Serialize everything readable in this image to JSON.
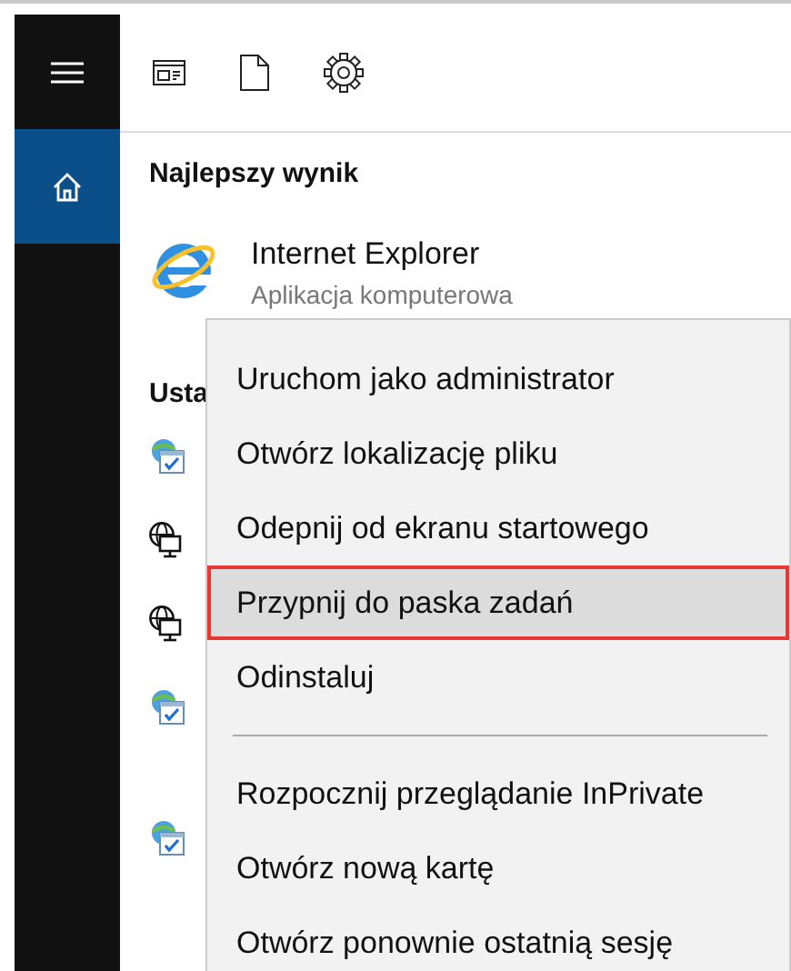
{
  "sidebar": {
    "items": [
      {
        "kind": "menu",
        "selected": false
      },
      {
        "kind": "home",
        "selected": true
      }
    ]
  },
  "toolbar": {
    "icons": [
      {
        "kind": "apps"
      },
      {
        "kind": "documents"
      },
      {
        "kind": "settings"
      }
    ]
  },
  "best_match": {
    "heading": "Najlepszy wynik",
    "title": "Internet Explorer",
    "subtitle": "Aplikacja komputerowa"
  },
  "settings": {
    "heading": "Usta",
    "items": [
      {
        "kind": "ie-settings"
      },
      {
        "kind": "network"
      },
      {
        "kind": "network"
      },
      {
        "kind": "ie-settings"
      },
      {
        "kind": "ie-settings"
      }
    ]
  },
  "context_menu": {
    "groups": [
      [
        {
          "label": "Uruchom jako administrator",
          "selected": false
        },
        {
          "label": "Otwórz lokalizację pliku",
          "selected": false
        },
        {
          "label": "Odepnij od ekranu startowego",
          "selected": false
        },
        {
          "label": "Przypnij do paska zadań",
          "selected": true
        },
        {
          "label": "Odinstaluj",
          "selected": false
        }
      ],
      [
        {
          "label": "Rozpocznij przeglądanie InPrivate",
          "selected": false
        },
        {
          "label": "Otwórz nową kartę",
          "selected": false
        },
        {
          "label": "Otwórz ponownie ostatnią sesję",
          "selected": false
        }
      ]
    ]
  }
}
